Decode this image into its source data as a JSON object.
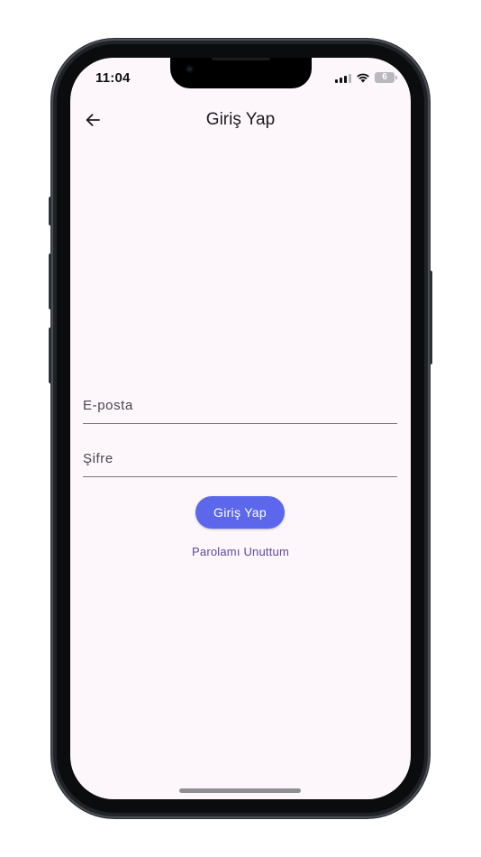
{
  "status_bar": {
    "time": "11:04",
    "battery_level": "6"
  },
  "app_bar": {
    "title": "Giriş Yap",
    "back_icon": "arrow-left-icon"
  },
  "form": {
    "email_placeholder": "E-posta",
    "email_value": "",
    "password_placeholder": "Şifre",
    "password_value": "",
    "submit_label": "Giriş Yap",
    "forgot_password_label": "Parolamı Unuttum"
  },
  "colors": {
    "screen_background": "#fdf7fc",
    "primary_button": "#5c67ec",
    "link": "#5a4a9c",
    "underline": "#79757f"
  }
}
